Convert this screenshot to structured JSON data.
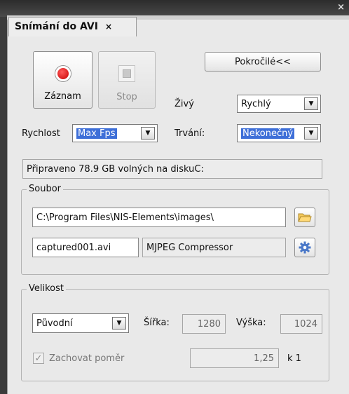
{
  "tab": {
    "title": "Snímání do AVI",
    "close": "×"
  },
  "window": {
    "close": "×"
  },
  "buttons": {
    "record": "Záznam",
    "stop": "Stop",
    "advanced": "Pokročilé<<"
  },
  "live": {
    "label": "Živý",
    "value": "Rychlý"
  },
  "speed": {
    "label": "Rychlost",
    "value": "Max Fps"
  },
  "duration": {
    "label": "Trvání:",
    "value": "Nekonečný"
  },
  "status": "Připraveno 78.9 GB volných na diskuC:",
  "file": {
    "legend": "Soubor",
    "path": "C:\\Program Files\\NIS-Elements\\images\\",
    "filename": "captured001.avi",
    "compressor": "MJPEG Compressor"
  },
  "size": {
    "legend": "Velikost",
    "mode": "Původní",
    "width_label": "Šířka:",
    "width": "1280",
    "height_label": "Výška:",
    "height": "1024",
    "keep_ratio_label": "Zachovat poměr",
    "keep_ratio_checked": true,
    "ratio": "1,25",
    "ratio_suffix": "k 1"
  },
  "icons": {
    "record": "record-dot",
    "stop": "stop-square",
    "folder": "folder",
    "settings": "gear"
  },
  "colors": {
    "record": "#d40000",
    "selection": "#3e6fd8",
    "folder": "#f3c85b",
    "gear": "#4a78c8"
  }
}
